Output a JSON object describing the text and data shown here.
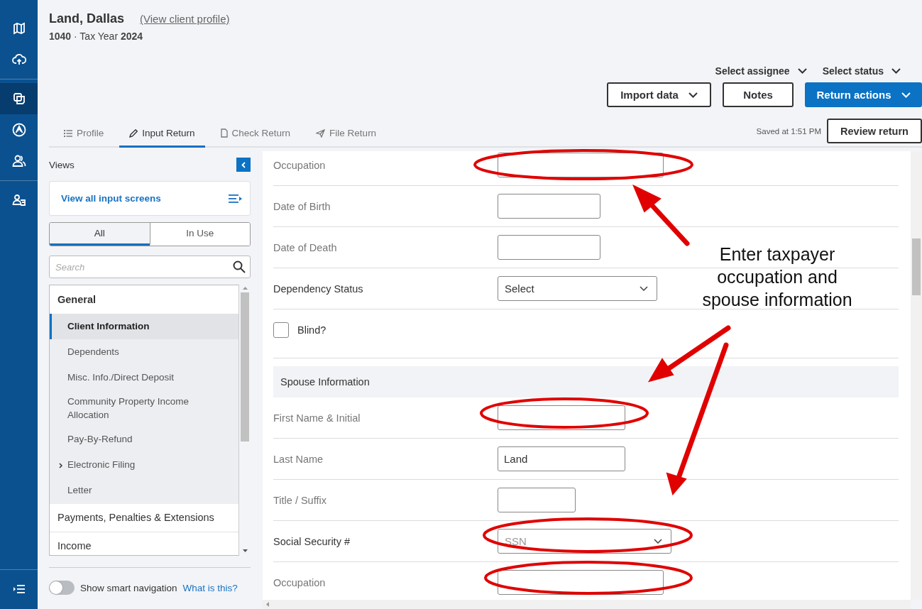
{
  "client": {
    "name": "Land, Dallas",
    "profile_link": "(View client profile)",
    "subtitle": "**1040** · Tax Year **2024**"
  },
  "header_menus": [
    "Select assignee",
    "Select status"
  ],
  "actions": [
    {
      "label": "Import data",
      "kind": "dropdown"
    },
    {
      "label": "Notes",
      "kind": "plain"
    },
    {
      "label": "Return actions",
      "kind": "primary"
    }
  ],
  "saved": "Saved at 1:51 PM",
  "review_button": "Review return",
  "tabs": [
    {
      "label": "Profile",
      "selected": false
    },
    {
      "label": "Input Return",
      "selected": true
    },
    {
      "label": "Check Return",
      "selected": false
    },
    {
      "label": "File Return",
      "selected": false
    }
  ],
  "rail": [
    {
      "selected": false
    },
    {
      "selected": false
    },
    {
      "selected": true
    },
    {
      "selected": false
    },
    {
      "selected": false
    },
    {
      "selected": false
    }
  ],
  "views": {
    "title": "Views",
    "all_screens": "View all input screens",
    "filters": [
      {
        "label": "All",
        "selected": true
      },
      {
        "label": "In Use",
        "selected": false
      }
    ],
    "search_placeholder": "Search",
    "tree": [
      {
        "label": "General",
        "expanded": true,
        "children": [
          {
            "label": "Client Information",
            "selected": true
          },
          {
            "label": "Dependents",
            "selected": false
          },
          {
            "label": "Misc. Info./Direct Deposit",
            "selected": false
          },
          {
            "label": "Community Property Income Allocation",
            "selected": false
          },
          {
            "label": "Pay-By-Refund",
            "selected": false
          },
          {
            "label": "Electronic Filing",
            "selected": false,
            "expandable": true
          },
          {
            "label": "Letter",
            "selected": false
          }
        ]
      },
      {
        "label": "Payments, Penalties & Extensions",
        "expanded": false
      },
      {
        "label": "Income",
        "expanded": false
      }
    ],
    "smart_nav": {
      "label": "Show smart navigation",
      "on": false,
      "help": "What is this?"
    }
  },
  "form": [
    {
      "kind": "text",
      "label": "Occupation"
    },
    {
      "kind": "text",
      "label": "Date of Birth"
    },
    {
      "kind": "text",
      "label": "Date of Death"
    },
    {
      "kind": "select",
      "label": "Dependency Status",
      "value": "Select"
    },
    {
      "kind": "checkbox",
      "label": "Blind?",
      "checked": false
    },
    {
      "kind": "section",
      "label": "Spouse Information"
    },
    {
      "kind": "text",
      "label": "First Name & Initial"
    },
    {
      "kind": "text",
      "label": "Last Name",
      "value": "Land"
    },
    {
      "kind": "text",
      "label": "Title / Suffix"
    },
    {
      "kind": "select",
      "label": "Social Security #",
      "placeholder": "SSN"
    },
    {
      "kind": "text",
      "label": "Occupation"
    }
  ],
  "annotation": {
    "text": "Enter taxpayer occupation and spouse information"
  }
}
